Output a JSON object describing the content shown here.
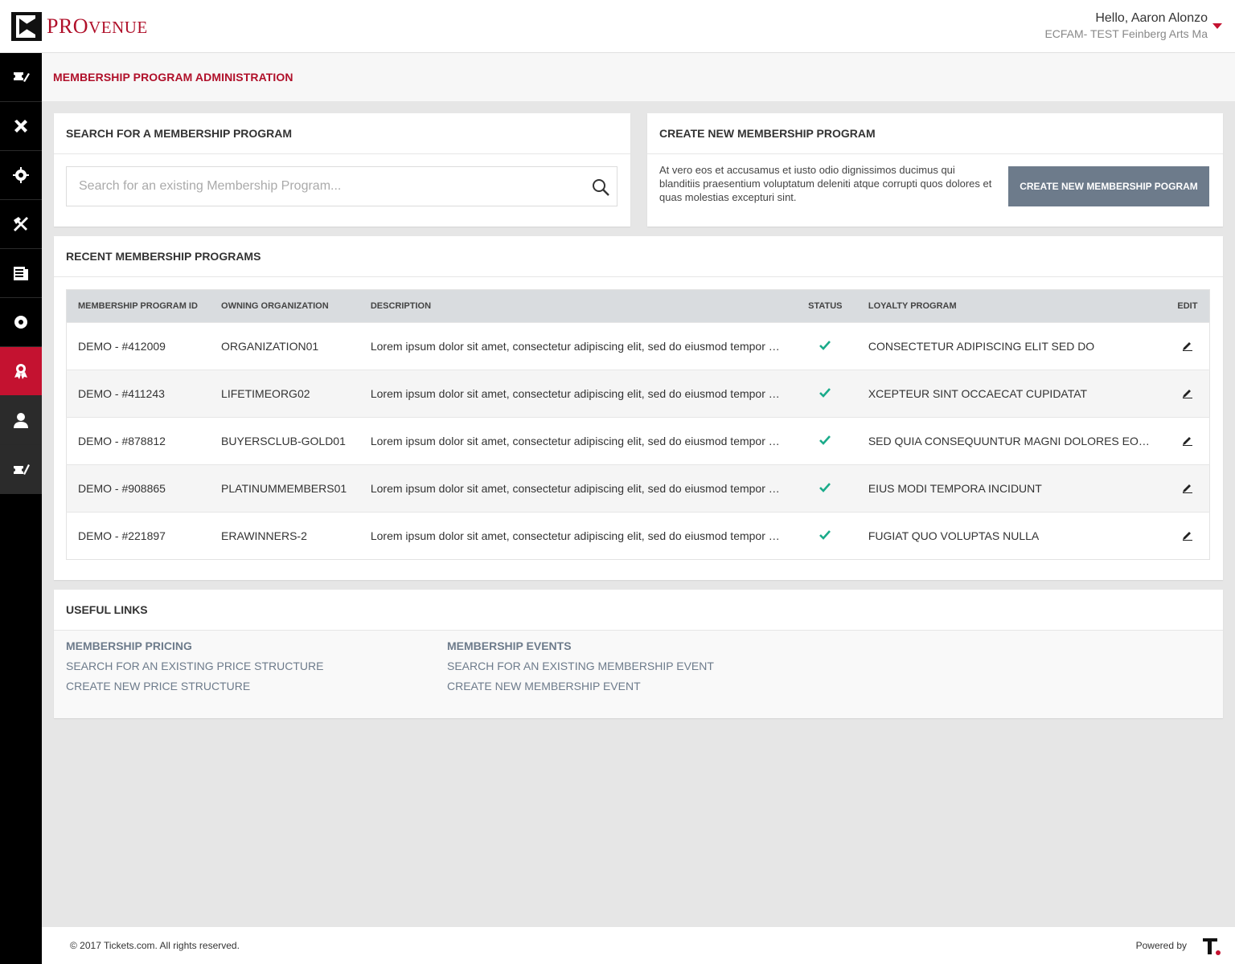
{
  "app": {
    "logo_text_big": "PRO",
    "logo_text_small": "VENUE",
    "brand_color": "#c41230"
  },
  "user": {
    "greeting": "Hello, Aaron Alonzo",
    "organization": "ECFAM- TEST Feinberg Arts Ma"
  },
  "sidebar": {
    "items": [
      {
        "icon": "ticket-edit-icon"
      },
      {
        "icon": "tools-cross-icon"
      },
      {
        "icon": "gear-icon"
      },
      {
        "icon": "hammer-wrench-icon"
      },
      {
        "icon": "document-icon"
      },
      {
        "icon": "cog-icon"
      },
      {
        "icon": "membership-ribbon-icon",
        "active": true
      },
      {
        "icon": "user-icon"
      },
      {
        "icon": "ticket-pen-icon"
      }
    ]
  },
  "page": {
    "title": "MEMBERSHIP PROGRAM ADMINISTRATION"
  },
  "search_panel": {
    "heading": "SEARCH FOR A MEMBERSHIP PROGRAM",
    "placeholder": "Search for an existing Membership Program...",
    "value": ""
  },
  "create_panel": {
    "heading": "CREATE NEW MEMBERSHIP PROGRAM",
    "text": "At vero eos et accusamus et iusto odio dignissimos ducimus qui blanditiis praesentium voluptatum deleniti atque corrupti quos dolores et quas molestias excepturi sint.",
    "button_label": "CREATE NEW MEMBERSHIP POGRAM"
  },
  "recent_panel": {
    "heading": "RECENT MEMBERSHIP PROGRAMS",
    "columns": [
      "MEMBERSHIP PROGRAM ID",
      "OWNING ORGANIZATION",
      "DESCRIPTION",
      "STATUS",
      "LOYALTY PROGRAM",
      "EDIT"
    ],
    "rows": [
      {
        "id": "DEMO - #412009",
        "org": "ORGANIZATION01",
        "description": "Lorem ipsum dolor sit amet, consectetur adipiscing elit, sed do eiusmod tempor incididunt",
        "status": "active",
        "loyalty": "CONSECTETUR ADIPISCING ELIT SED DO"
      },
      {
        "id": "DEMO - #411243",
        "org": "LIFETIMEORG02",
        "description": "Lorem ipsum dolor sit amet, consectetur adipiscing elit, sed do eiusmod tempor incididunt",
        "status": "active",
        "loyalty": "XCEPTEUR SINT OCCAECAT CUPIDATAT"
      },
      {
        "id": "DEMO - #878812",
        "org": "BUYERSCLUB-GOLD01",
        "description": "Lorem ipsum dolor sit amet, consectetur adipiscing elit, sed do eiusmod tempor incididunt",
        "status": "active",
        "loyalty": "SED QUIA CONSEQUUNTUR MAGNI DOLORES EOS QUI RATIONE"
      },
      {
        "id": "DEMO - #908865",
        "org": "PLATINUMMEMBERS01",
        "description": "Lorem ipsum dolor sit amet, consectetur adipiscing elit, sed do eiusmod tempor incididunt",
        "status": "active",
        "loyalty": "EIUS MODI TEMPORA INCIDUNT"
      },
      {
        "id": "DEMO - #221897",
        "org": "ERAWINNERS-2",
        "description": "Lorem ipsum dolor sit amet, consectetur adipiscing elit, sed do eiusmod tempor incididunt",
        "status": "active",
        "loyalty": "FUGIAT QUO VOLUPTAS NULLA"
      }
    ],
    "status_color": "#1aab8a"
  },
  "useful_links": {
    "heading": "USEFUL LINKS",
    "pricing": {
      "title": "MEMBERSHIP PRICING",
      "links": [
        "SEARCH FOR AN EXISTING PRICE STRUCTURE",
        "CREATE NEW PRICE STRUCTURE"
      ]
    },
    "events": {
      "title": "MEMBERSHIP EVENTS",
      "links": [
        "SEARCH FOR AN EXISTING MEMBERSHIP EVENT",
        "CREATE NEW MEMBERSHIP EVENT"
      ]
    }
  },
  "footer": {
    "copyright": "© 2017 Tickets.com. All rights reserved.",
    "powered_by": "Powered by",
    "powered_logo": "T"
  }
}
